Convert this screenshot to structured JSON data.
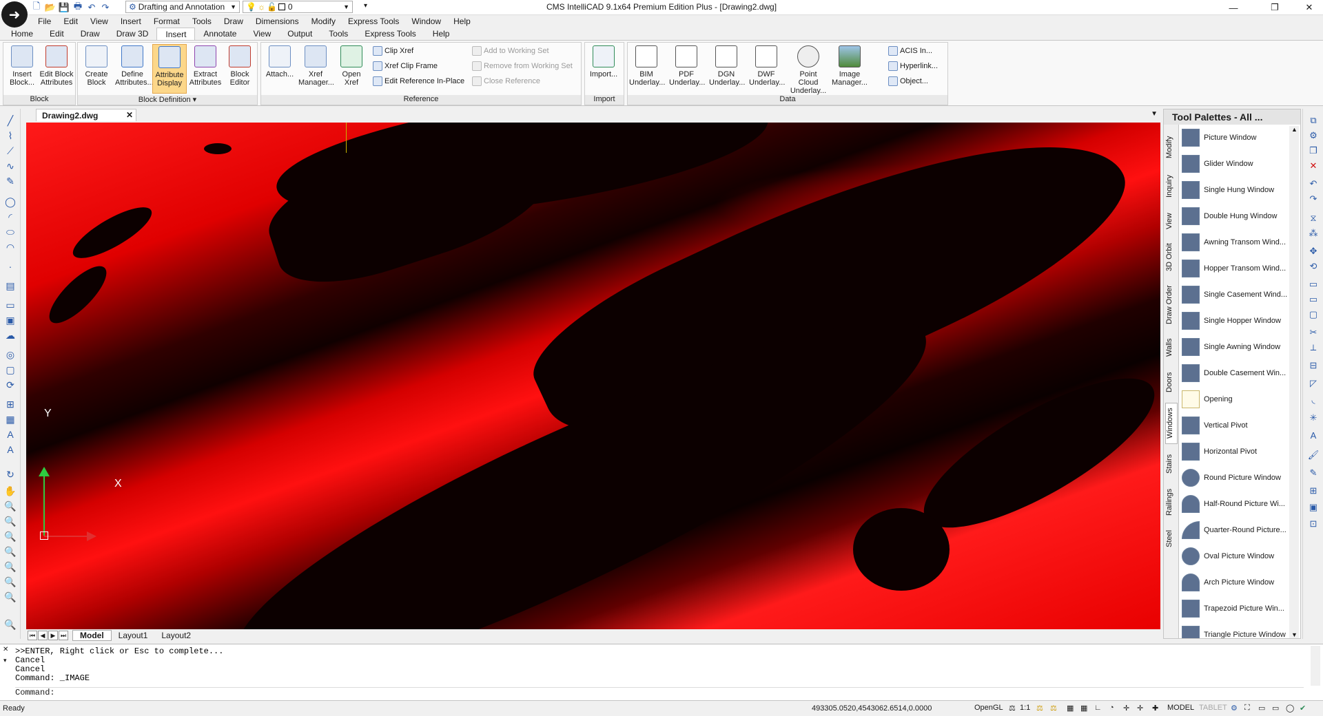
{
  "window": {
    "title": "CMS IntelliCAD 9.1x64 Premium Edition Plus  - [Drawing2.dwg]",
    "workspace": "Drafting and Annotation",
    "layer": "0"
  },
  "menus": [
    "File",
    "Edit",
    "View",
    "Insert",
    "Format",
    "Tools",
    "Draw",
    "Dimensions",
    "Modify",
    "Express Tools",
    "Window",
    "Help"
  ],
  "ribbon_tabs": [
    "Home",
    "Edit",
    "Draw",
    "Draw 3D",
    "Insert",
    "Annotate",
    "View",
    "Output",
    "Tools",
    "Express Tools",
    "Help"
  ],
  "ribbon": {
    "block": {
      "title": "Block",
      "insert": "Insert Block...",
      "edit": "Edit Block Attributes"
    },
    "block_def": {
      "title": "Block Definition",
      "create": "Create Block",
      "define": "Define Attributes...",
      "display": "Attribute Display",
      "extract": "Extract Attributes",
      "editor": "Block Editor"
    },
    "reference": {
      "title": "Reference",
      "attach": "Attach...",
      "xref_manager": "Xref Manager...",
      "open_xref": "Open Xref",
      "clip_xref": "Clip Xref",
      "xref_clip_frame": "Xref Clip Frame",
      "edit_ref": "Edit Reference In-Place",
      "add_ws": "Add to Working Set",
      "remove_ws": "Remove from Working Set",
      "close_ref": "Close Reference"
    },
    "import": {
      "title": "Import",
      "import": "Import..."
    },
    "data": {
      "title": "Data",
      "bim": "BIM Underlay...",
      "pdf": "PDF Underlay...",
      "dgn": "DGN Underlay...",
      "dwf": "DWF Underlay...",
      "point_cloud": "Point Cloud Underlay...",
      "image_manager": "Image Manager...",
      "acis": "ACIS In...",
      "hyperlink": "Hyperlink...",
      "object": "Object..."
    }
  },
  "document_tab": "Drawing2.dwg",
  "layout_tabs": [
    "Model",
    "Layout1",
    "Layout2"
  ],
  "ucs": {
    "x": "X",
    "y": "Y"
  },
  "palette": {
    "title": "Tool Palettes - All ...",
    "tabs": [
      "Modify",
      "Inquiry",
      "View",
      "3D Orbit",
      "Draw Order",
      "Walls",
      "Doors",
      "Windows",
      "Stairs",
      "Railings",
      "Steel"
    ],
    "items": [
      "Picture Window",
      "Glider Window",
      "Single Hung Window",
      "Double Hung Window",
      "Awning Transom Wind...",
      "Hopper Transom Wind...",
      "Single Casement Wind...",
      "Single Hopper Window",
      "Single Awning Window",
      "Double Casement Win...",
      "Opening",
      "Vertical Pivot",
      "Horizontal Pivot",
      "Round Picture Window",
      "Half-Round Picture Wi...",
      "Quarter-Round Picture...",
      "Oval Picture Window",
      "Arch Picture Window",
      "Trapezoid Picture Win...",
      "Triangle Picture Window"
    ]
  },
  "command": {
    "lines": [
      ">>ENTER, Right click or Esc to complete...",
      "Cancel",
      "Cancel",
      "Command: _IMAGE"
    ],
    "prompt": "Command:"
  },
  "status": {
    "ready": "Ready",
    "coords": "493305.0520,4543062.6514,0.0000",
    "renderer": "OpenGL",
    "scale": "1:1",
    "mode": "MODEL",
    "tablet": "TABLET"
  },
  "colors": {
    "terrain_red": "#ff1010",
    "terrain_dark": "#0c0000",
    "accent_selected": "#fcd78a"
  }
}
